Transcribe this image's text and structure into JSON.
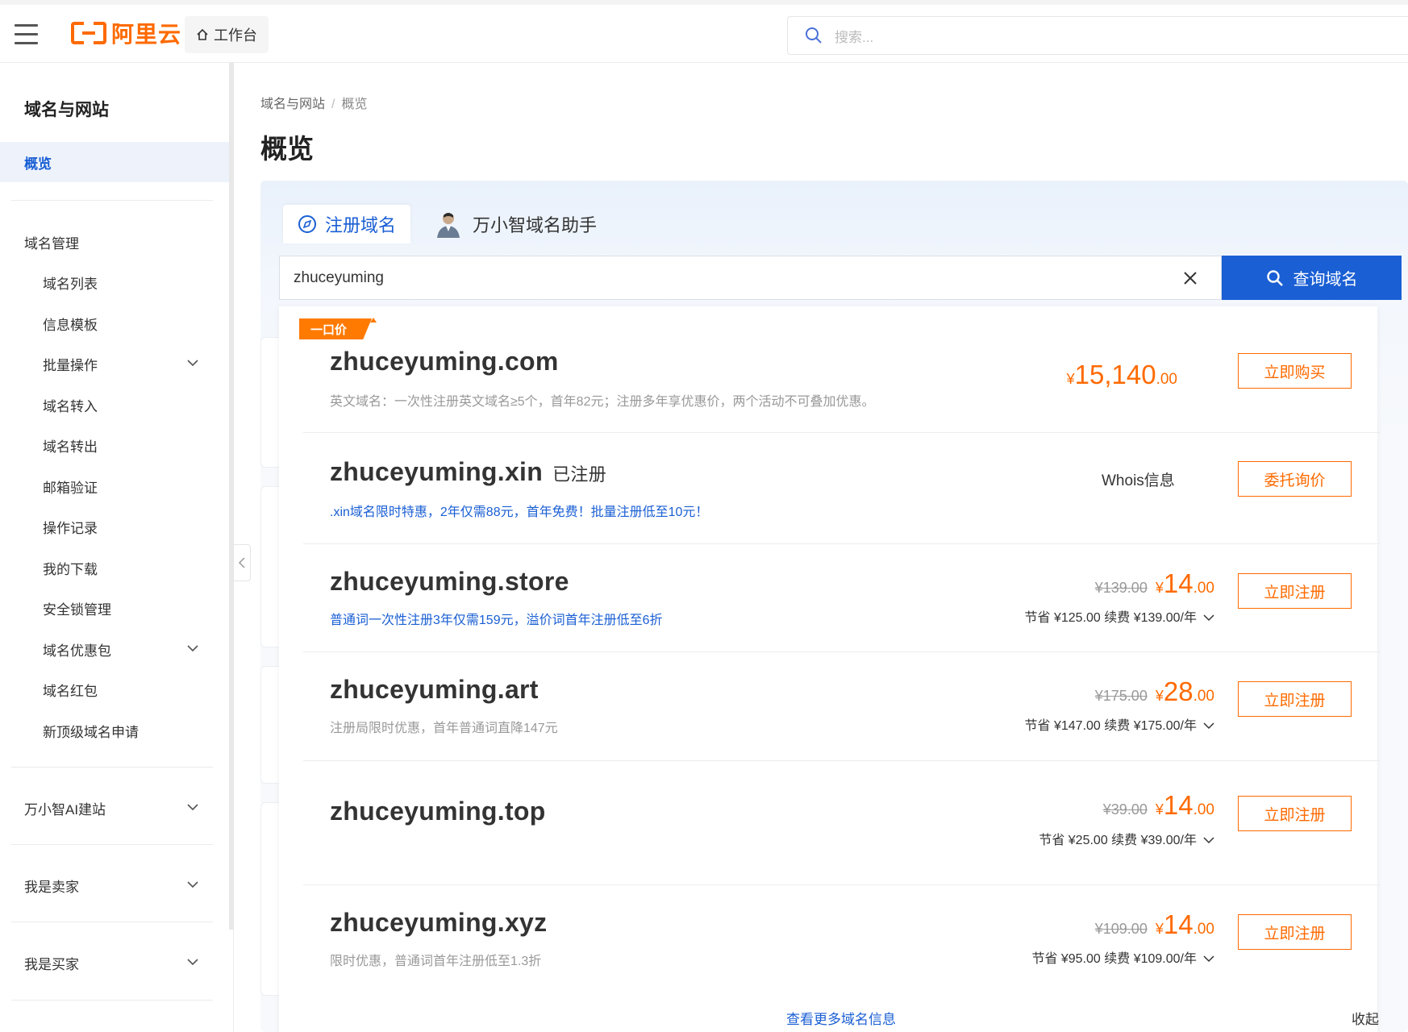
{
  "header": {
    "brand": "阿里云",
    "workbench_label": "工作台",
    "search_placeholder": "搜索..."
  },
  "sidebar": {
    "title": "域名与网站",
    "active_item": "概览",
    "group_domain": "域名管理",
    "sub_items": [
      "域名列表",
      "信息模板",
      "批量操作",
      "域名转入",
      "域名转出",
      "邮箱验证",
      "操作记录",
      "我的下载",
      "安全锁管理",
      "域名优惠包",
      "域名红包",
      "新顶级域名申请"
    ],
    "groups": [
      "万小智AI建站",
      "我是卖家",
      "我是买家"
    ]
  },
  "breadcrumb": {
    "root": "域名与网站",
    "separator": "/",
    "current": "概览"
  },
  "page_title": "概览",
  "tabs": {
    "register": "注册域名",
    "assistant": "万小智域名助手"
  },
  "query": {
    "value": "zhuceyuming",
    "button_label": "查询域名"
  },
  "results": [
    {
      "badge": "一口价",
      "domain": "zhuceyuming.com",
      "desc": "英文域名：一次性注册英文域名≥5个，首年82元；注册多年享优惠价，两个活动不可叠加优惠。",
      "currency": "¥",
      "price_int": "15,140",
      "price_dec": ".00",
      "action": "立即购买"
    },
    {
      "domain": "zhuceyuming.xin",
      "status": "已注册",
      "desc": ".xin域名限时特惠，2年仅需88元，首年免费！批量注册低至10元！",
      "whois": "Whois信息",
      "action": "委托询价"
    },
    {
      "domain": "zhuceyuming.store",
      "desc": "普通词一次性注册3年仅需159元，溢价词首年注册低至6折",
      "old_price": "¥139.00",
      "currency": "¥",
      "price_int": "14",
      "price_dec": ".00",
      "savings": "节省 ¥125.00 续费 ¥139.00/年",
      "action": "立即注册"
    },
    {
      "domain": "zhuceyuming.art",
      "desc": "注册局限时优惠，首年普通词直降147元",
      "old_price": "¥175.00",
      "currency": "¥",
      "price_int": "28",
      "price_dec": ".00",
      "savings": "节省 ¥147.00 续费 ¥175.00/年",
      "action": "立即注册"
    },
    {
      "domain": "zhuceyuming.top",
      "old_price": "¥39.00",
      "currency": "¥",
      "price_int": "14",
      "price_dec": ".00",
      "savings": "节省 ¥25.00 续费 ¥39.00/年",
      "action": "立即注册"
    },
    {
      "domain": "zhuceyuming.xyz",
      "desc": "限时优惠，普通词首年注册低至1.3折",
      "old_price": "¥109.00",
      "currency": "¥",
      "price_int": "14",
      "price_dec": ".00",
      "savings": "节省 ¥95.00 续费 ¥109.00/年",
      "action": "立即注册"
    }
  ],
  "footer": {
    "more_link": "查看更多域名信息",
    "collapse": "收起"
  },
  "colors": {
    "brand_orange": "#ff6a00",
    "primary_blue": "#1a5fd4"
  }
}
